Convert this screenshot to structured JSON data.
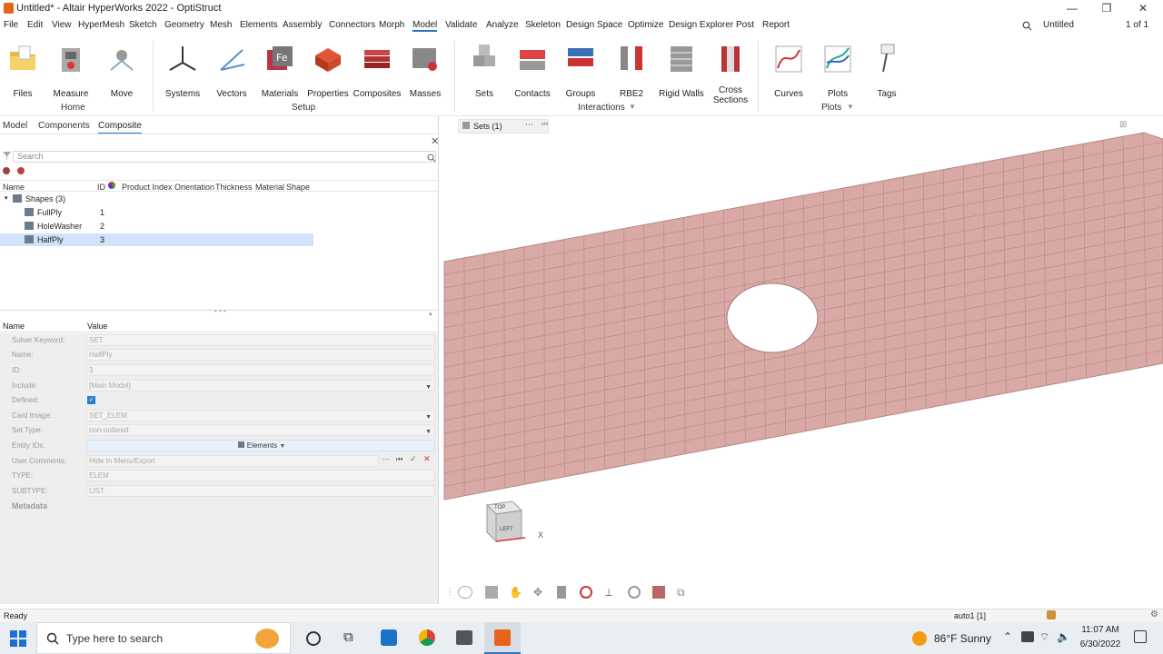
{
  "window": {
    "title": "Untitled* - Altair HyperWorks 2022 - OptiStruct",
    "buttons": [
      "—",
      "❐",
      "✕"
    ]
  },
  "menubar": {
    "items": [
      "File",
      "Edit",
      "View",
      "HyperMesh",
      "Sketch",
      "Geometry",
      "Mesh",
      "Elements",
      "Assembly",
      "Connectors",
      "Morph",
      "Model",
      "Validate",
      "Analyze",
      "Skeleton",
      "Design Space",
      "Optimize",
      "Design Explorer",
      "Post",
      "Report"
    ],
    "active": "Model",
    "right": {
      "model_name": "Untitled",
      "page": "1 of 1"
    }
  },
  "ribbon": {
    "buttons": [
      {
        "label": "Files",
        "icon": "folder-icon"
      },
      {
        "label": "Measure",
        "icon": "measure-icon"
      },
      {
        "label": "Move",
        "icon": "move-icon"
      },
      {
        "label": "Systems",
        "icon": "systems-icon"
      },
      {
        "label": "Vectors",
        "icon": "vectors-icon"
      },
      {
        "label": "Materials",
        "icon": "materials-icon"
      },
      {
        "label": "Properties",
        "icon": "properties-icon"
      },
      {
        "label": "Composites",
        "icon": "composites-icon"
      },
      {
        "label": "Masses",
        "icon": "masses-icon"
      },
      {
        "label": "Sets",
        "icon": "sets-icon"
      },
      {
        "label": "Contacts",
        "icon": "contacts-icon"
      },
      {
        "label": "Groups",
        "icon": "groups-icon"
      },
      {
        "label": "RBE2",
        "icon": "rbe2-icon"
      },
      {
        "label": "Rigid Walls",
        "icon": "rigid-walls-icon"
      },
      {
        "label": "Cross Sections",
        "icon": "cross-sections-icon"
      },
      {
        "label": "Curves",
        "icon": "curves-icon"
      },
      {
        "label": "Plots",
        "icon": "plots-icon"
      },
      {
        "label": "Tags",
        "icon": "tags-icon"
      }
    ],
    "groups": [
      "Home",
      "Setup",
      "Interactions",
      "Plots"
    ]
  },
  "left_panel": {
    "tabs": [
      "Model",
      "Components",
      "Composite"
    ],
    "active_tab": "Composite",
    "search_placeholder": "Search",
    "columns": [
      "Name",
      "ID",
      "Product Index",
      "Orientation",
      "Thickness",
      "Material",
      "Shape"
    ],
    "tree": {
      "root": "Shapes (3)",
      "rows": [
        {
          "name": "FullPly",
          "id": "1",
          "selected": false
        },
        {
          "name": "HoleWasher",
          "id": "2",
          "selected": false
        },
        {
          "name": "HalfPly",
          "id": "3",
          "selected": true
        }
      ]
    }
  },
  "properties": {
    "header": {
      "name": "Name",
      "value": "Value"
    },
    "rows": [
      {
        "name": "Solver Keyword:",
        "value": "SET"
      },
      {
        "name": "Name:",
        "value": "HalfPly"
      },
      {
        "name": "ID:",
        "value": "3"
      },
      {
        "name": "Include:",
        "value": "[Main Model]"
      },
      {
        "name": "Defined:",
        "value": ""
      },
      {
        "name": "Card Image:",
        "value": "SET_ELEM"
      },
      {
        "name": "Set Type:",
        "value": "non-ordered"
      },
      {
        "name": "Entity IDs:",
        "value": "Elements"
      },
      {
        "name": "User Comments:",
        "value": "Hide In Menu/Export"
      },
      {
        "name": "TYPE:",
        "value": "ELEM"
      },
      {
        "name": "SUBTYPE:",
        "value": "LIST"
      }
    ],
    "metadata": "Metadata",
    "defined_checked": true
  },
  "viewport": {
    "sets_chip": "Sets (1)",
    "cube_top": "TOP",
    "cube_left": "LEFT",
    "axis_label": "X",
    "mesh_color": "#d9a9a5"
  },
  "statusbar": {
    "status": "Ready",
    "auto": "auto1 [1]"
  },
  "taskbar": {
    "search_placeholder": "Type here to search",
    "weather": "86°F  Sunny",
    "time": "11:07 AM",
    "date": "6/30/2022"
  }
}
